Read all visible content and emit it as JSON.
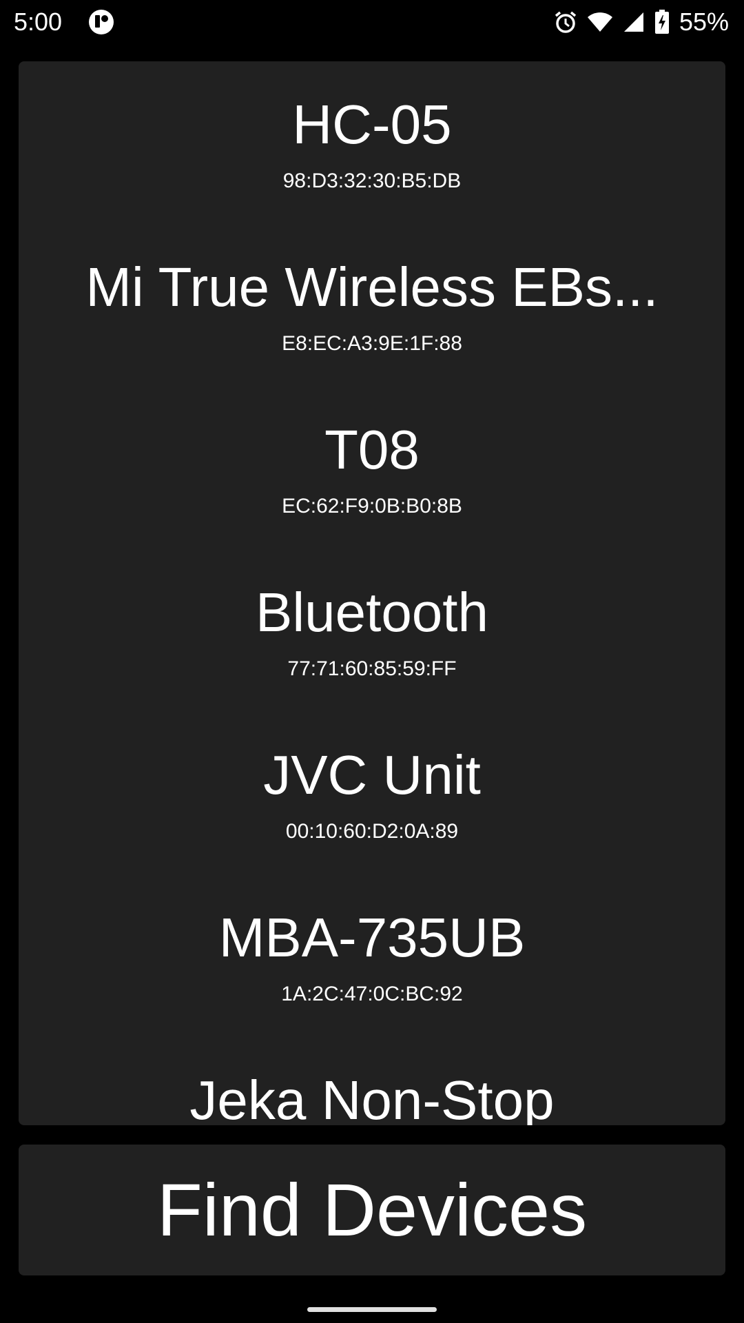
{
  "status_bar": {
    "time": "5:00",
    "battery_percent": "55%",
    "icons": [
      "app-notification-icon",
      "alarm-icon",
      "wifi-icon",
      "cell-signal-icon",
      "battery-charging-icon"
    ]
  },
  "devices": [
    {
      "name": "HC-05",
      "address": "98:D3:32:30:B5:DB"
    },
    {
      "name": "Mi True Wireless EBs...",
      "address": "E8:EC:A3:9E:1F:88"
    },
    {
      "name": "T08",
      "address": "EC:62:F9:0B:B0:8B"
    },
    {
      "name": "Bluetooth",
      "address": "77:71:60:85:59:FF"
    },
    {
      "name": "JVC Unit",
      "address": "00:10:60:D2:0A:89"
    },
    {
      "name": "MBA-735UB",
      "address": "1A:2C:47:0C:BC:92"
    },
    {
      "name": "Jeka Non-Stop",
      "address": ""
    }
  ],
  "find_button": {
    "label": "Find Devices"
  },
  "colors": {
    "background": "#000000",
    "panel": "#212121",
    "text": "#ffffff"
  }
}
